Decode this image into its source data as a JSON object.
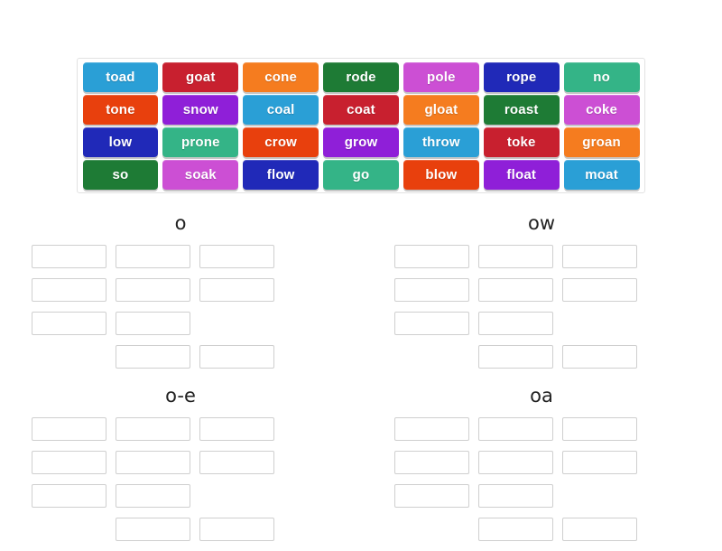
{
  "activity": {
    "type": "group-sort",
    "tray_label": "word-tiles-tray"
  },
  "tiles": [
    [
      {
        "word": "toad",
        "color": "#2a9fd6"
      },
      {
        "word": "goat",
        "color": "#c8202f"
      },
      {
        "word": "cone",
        "color": "#f57c1f"
      },
      {
        "word": "rode",
        "color": "#1e7b35"
      },
      {
        "word": "pole",
        "color": "#cc4fd4"
      },
      {
        "word": "rope",
        "color": "#2029b8"
      },
      {
        "word": "no",
        "color": "#34b487"
      }
    ],
    [
      {
        "word": "tone",
        "color": "#e8400d"
      },
      {
        "word": "snow",
        "color": "#8f1fd8"
      },
      {
        "word": "coal",
        "color": "#2a9fd6"
      },
      {
        "word": "coat",
        "color": "#c8202f"
      },
      {
        "word": "gloat",
        "color": "#f57c1f"
      },
      {
        "word": "roast",
        "color": "#1e7b35"
      },
      {
        "word": "coke",
        "color": "#cc4fd4"
      }
    ],
    [
      {
        "word": "low",
        "color": "#2029b8"
      },
      {
        "word": "prone",
        "color": "#34b487"
      },
      {
        "word": "crow",
        "color": "#e8400d"
      },
      {
        "word": "grow",
        "color": "#8f1fd8"
      },
      {
        "word": "throw",
        "color": "#2a9fd6"
      },
      {
        "word": "toke",
        "color": "#c8202f"
      },
      {
        "word": "groan",
        "color": "#f57c1f"
      }
    ],
    [
      {
        "word": "so",
        "color": "#1e7b35"
      },
      {
        "word": "soak",
        "color": "#cc4fd4"
      },
      {
        "word": "flow",
        "color": "#2029b8"
      },
      {
        "word": "go",
        "color": "#34b487"
      },
      {
        "word": "blow",
        "color": "#e8400d"
      },
      {
        "word": "float",
        "color": "#8f1fd8"
      },
      {
        "word": "moat",
        "color": "#2a9fd6"
      }
    ]
  ],
  "groups": [
    {
      "title": "o",
      "slots": 10,
      "filled": []
    },
    {
      "title": "ow",
      "slots": 10,
      "filled": []
    },
    {
      "title": "o-e",
      "slots": 10,
      "filled": []
    },
    {
      "title": "oa",
      "slots": 10,
      "filled": []
    }
  ],
  "colors": {
    "background": "#ffffff",
    "tray_border": "#e2e2e2",
    "slot_border": "#cfcfcf",
    "title_text": "#222222",
    "tile_text": "#ffffff"
  }
}
